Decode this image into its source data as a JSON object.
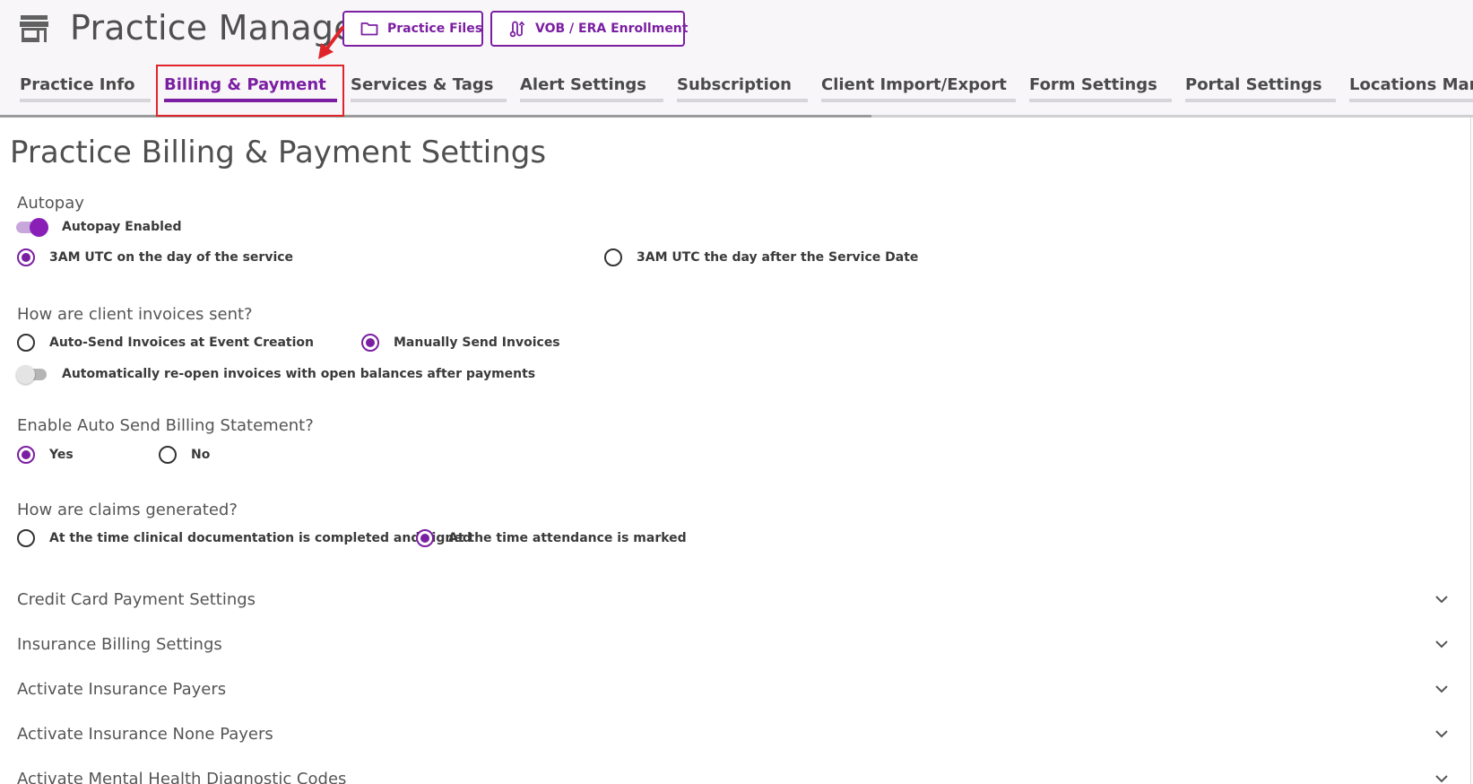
{
  "header": {
    "title": "Practice Manager",
    "buttons": {
      "files": "Practice Files",
      "vob": "VOB / ERA Enrollment"
    }
  },
  "tabs": [
    {
      "label": "Practice Info"
    },
    {
      "label": "Billing & Payment"
    },
    {
      "label": "Services & Tags"
    },
    {
      "label": "Alert Settings"
    },
    {
      "label": "Subscription"
    },
    {
      "label": "Client Import/Export"
    },
    {
      "label": "Form Settings"
    },
    {
      "label": "Portal Settings"
    },
    {
      "label": "Locations Manag"
    }
  ],
  "active_tab": "Billing & Payment",
  "page": {
    "title": "Practice Billing & Payment Settings"
  },
  "autopay": {
    "label": "Autopay",
    "toggle_label": "Autopay Enabled",
    "toggle_on": true,
    "option_day_of": "3AM UTC on the day of the service",
    "option_day_after": "3AM UTC the day after the Service Date",
    "selected": "day_of"
  },
  "invoices": {
    "label": "How are client invoices sent?",
    "option_auto": "Auto-Send Invoices at Event Creation",
    "option_manual": "Manually Send Invoices",
    "selected": "manual",
    "reopen_label": "Automatically re-open invoices with open balances after payments",
    "reopen_on": false
  },
  "statement": {
    "label": "Enable Auto Send Billing Statement?",
    "option_yes": "Yes",
    "option_no": "No",
    "selected": "yes"
  },
  "claims": {
    "label": "How are claims generated?",
    "option_documentation": "At the time clinical documentation is completed and signed",
    "option_attendance": "At the time attendance is marked",
    "selected": "attendance"
  },
  "accordions": [
    {
      "label": "Credit Card Payment Settings"
    },
    {
      "label": "Insurance Billing Settings"
    },
    {
      "label": "Activate Insurance Payers"
    },
    {
      "label": "Activate Insurance None Payers"
    },
    {
      "label": "Activate Mental Health Diagnostic Codes"
    }
  ],
  "colors": {
    "accent": "#7b1fa2",
    "annotation": "#e0252a"
  },
  "icons": {
    "app": "store-icon",
    "files": "folder-icon",
    "vob": "route-icon",
    "accordion": "chevron-down-icon",
    "annotation": "red-arrow"
  }
}
